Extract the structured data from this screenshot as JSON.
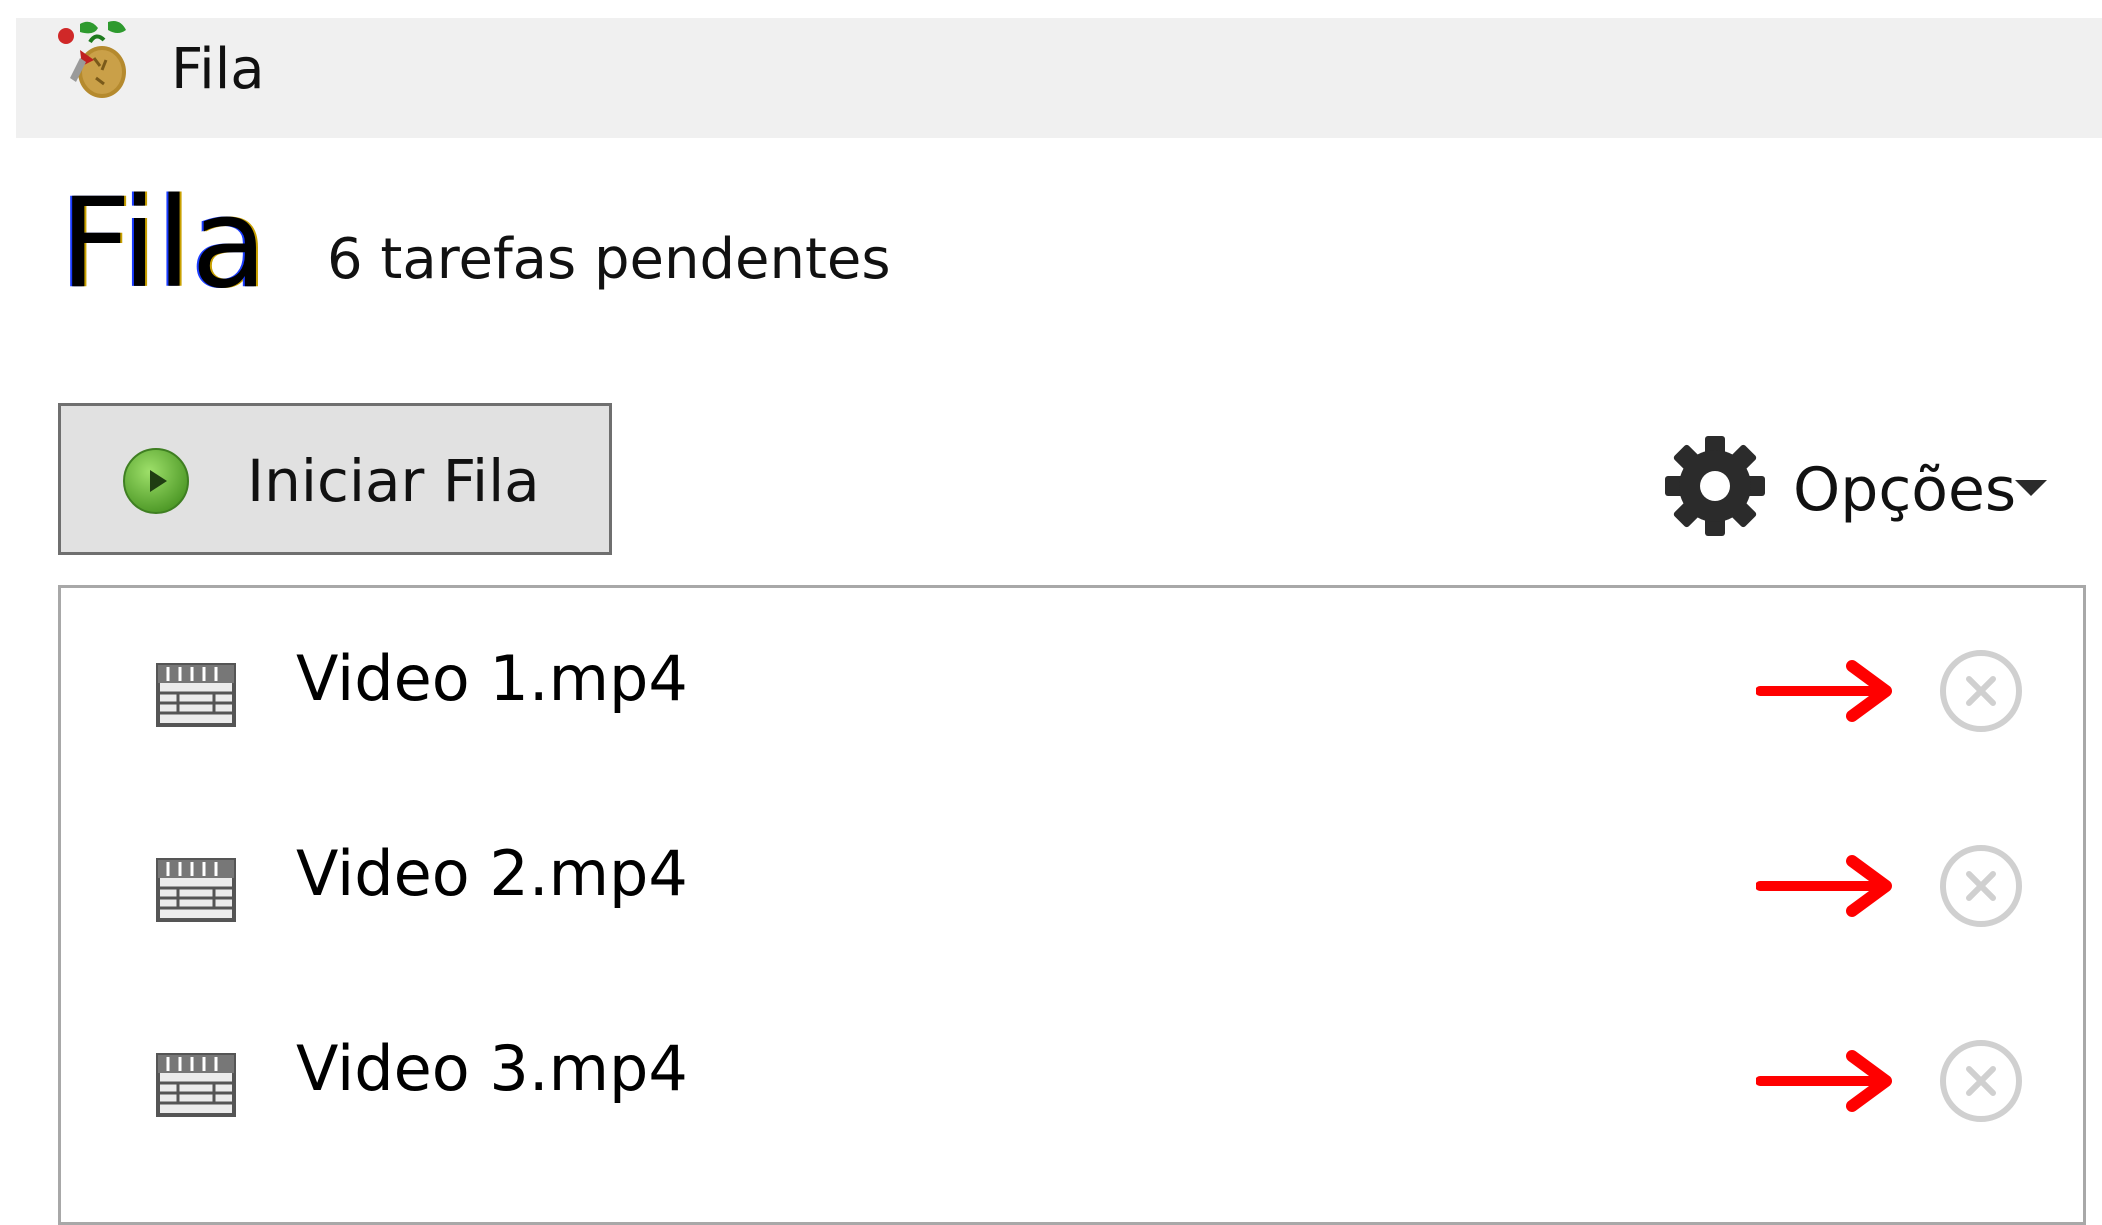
{
  "window": {
    "title": "Fila",
    "app_icon": "handbrake-pineapple-icon"
  },
  "header": {
    "title": "Fila",
    "pending": "6 tarefas pendentes"
  },
  "toolbar": {
    "start_label": "Iniciar Fila",
    "start_icon": "play-icon",
    "options_label": "Opções",
    "options_icon": "gear-icon"
  },
  "queue": {
    "items": [
      {
        "name": "Video 1.mp4"
      },
      {
        "name": "Video 2.mp4"
      },
      {
        "name": "Video 3.mp4"
      }
    ]
  },
  "colors": {
    "annotation_arrow": "#ff0000",
    "play_green": "#6ab43c",
    "remove_gray": "#d0d0d0"
  }
}
